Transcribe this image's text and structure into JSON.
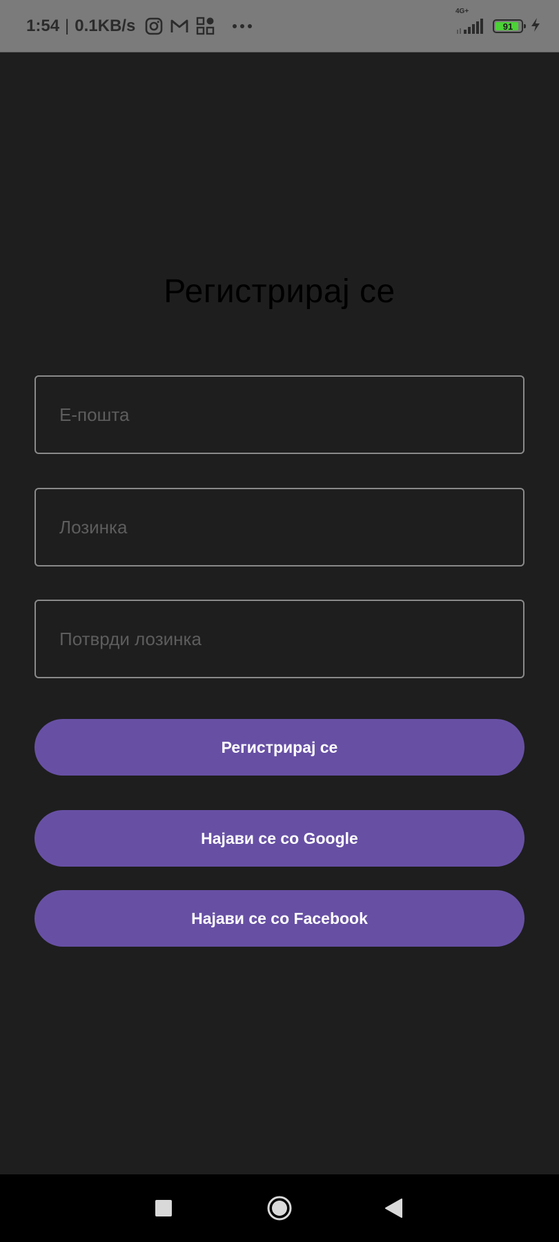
{
  "status_bar": {
    "time": "1:54",
    "separator": "|",
    "net_speed": "0.1KB/s",
    "icons": [
      "instagram-icon",
      "gmail-icon",
      "app-grid-icon",
      "more-dots-icon"
    ],
    "network_type": "4G+",
    "battery_level": "91",
    "battery_fraction": 0.91,
    "charging": true,
    "battery_color": "#4cd137"
  },
  "screen": {
    "title": "Регистрирај се",
    "fields": {
      "email_placeholder": "Е-пошта",
      "email_value": "",
      "password_placeholder": "Лозинка",
      "password_value": "",
      "confirm_placeholder": "Потврди лозинка",
      "confirm_value": ""
    },
    "buttons": {
      "register": "Регистрирај се",
      "google": "Најави се со Google",
      "facebook": "Најави се со Facebook"
    }
  },
  "nav_bar": {
    "icons": [
      "recents-square-icon",
      "home-circle-icon",
      "back-triangle-icon"
    ]
  },
  "colors": {
    "background": "#1e1e1e",
    "accent": "#6750a4",
    "status_bar": "#7b7b7b",
    "field_border": "#8a8a8a"
  }
}
